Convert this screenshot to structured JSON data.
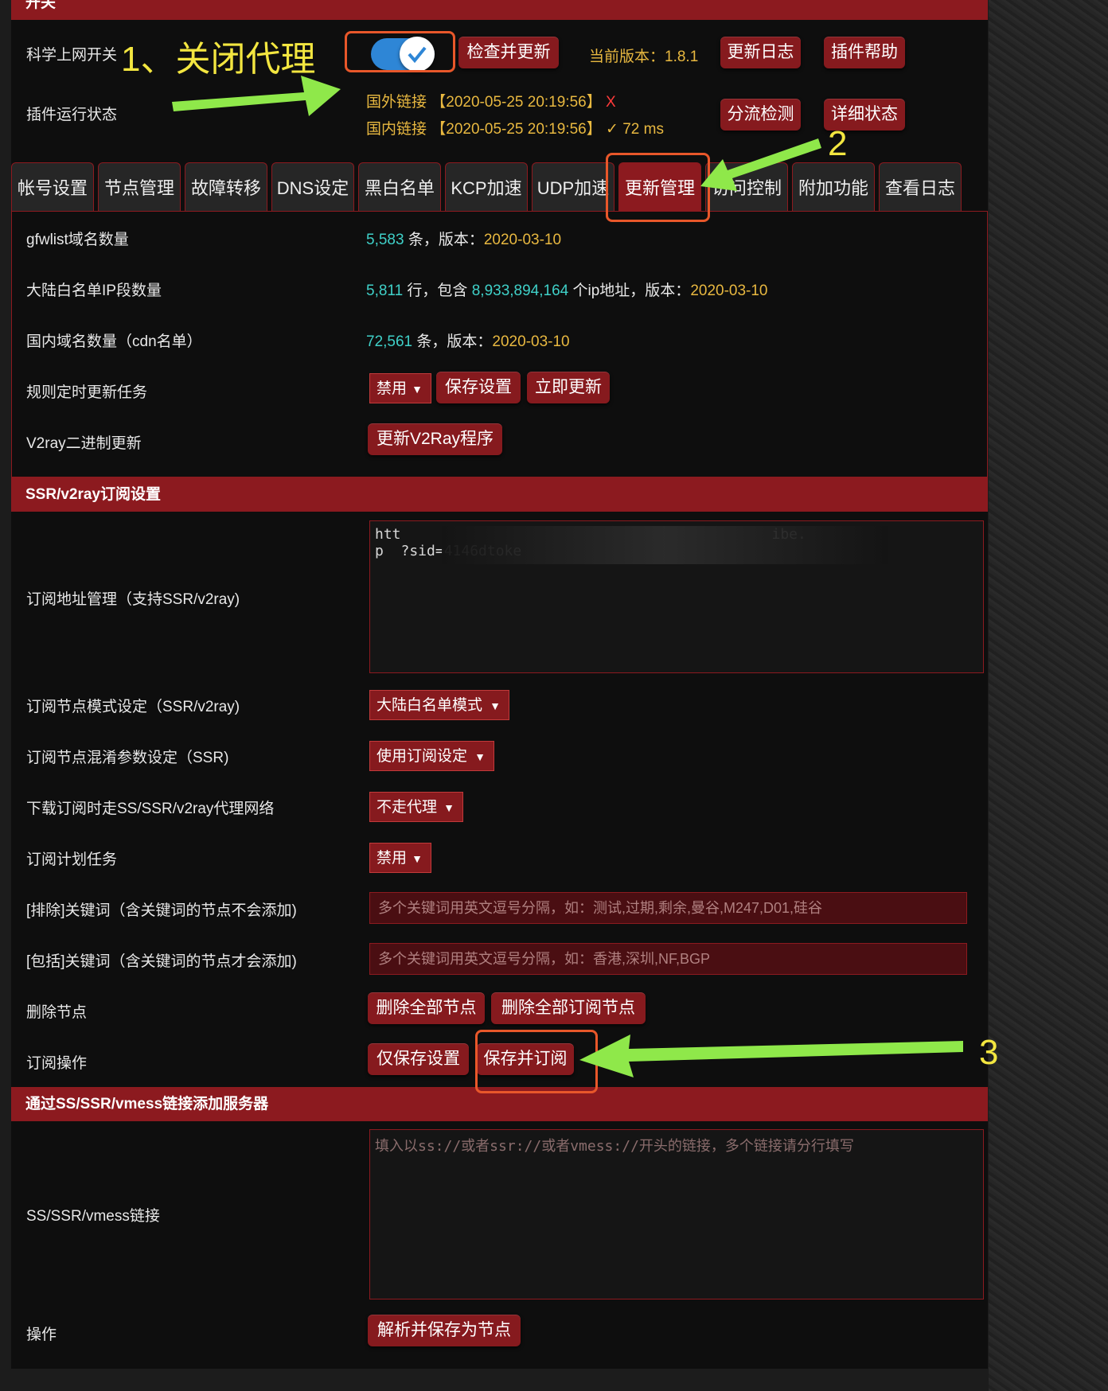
{
  "header": {
    "switch_section": "开关"
  },
  "switch_row": {
    "label": "科学上网开关",
    "check_update": "检查并更新",
    "version_label": "当前版本：",
    "version_value": "1.8.1",
    "changelog": "更新日志",
    "plugin_help": "插件帮助"
  },
  "status_row": {
    "label": "插件运行状态",
    "foreign_link": "国外链接 【2020-05-25 20:19:56】",
    "foreign_mark": "X",
    "domestic_link": "国内链接 【2020-05-25 20:19:56】",
    "domestic_mark": "✓ 72 ms",
    "split_check": "分流检测",
    "detail_status": "详细状态"
  },
  "tabs": [
    {
      "label": "帐号设置"
    },
    {
      "label": "节点管理"
    },
    {
      "label": "故障转移"
    },
    {
      "label": "DNS设定"
    },
    {
      "label": "黑白名单"
    },
    {
      "label": "KCP加速"
    },
    {
      "label": "UDP加速"
    },
    {
      "label": "更新管理"
    },
    {
      "label": "访问控制"
    },
    {
      "label": "附加功能"
    },
    {
      "label": "查看日志"
    }
  ],
  "rules": {
    "gfwlist_label": "gfwlist域名数量",
    "gfwlist_count": "5,583",
    "gfwlist_unit": "条，版本：",
    "gfwlist_version": "2020-03-10",
    "chnroute_label": "大陆白名单IP段数量",
    "chnroute_count": "5,811",
    "chnroute_mid": "行，包含",
    "chnroute_ips": "8,933,894,164",
    "chnroute_unit": "个ip地址，版本：",
    "chnroute_version": "2020-03-10",
    "cdn_label": "国内域名数量（cdn名单）",
    "cdn_count": "72,561",
    "cdn_unit": "条，版本：",
    "cdn_version": "2020-03-10",
    "schedule_label": "规则定时更新任务",
    "schedule_value": "禁用",
    "save_settings": "保存设置",
    "update_now": "立即更新",
    "v2ray_label": "V2ray二进制更新",
    "v2ray_button": "更新V2Ray程序"
  },
  "subscription": {
    "section_title": "SSR/v2ray订阅设置",
    "url_label": "订阅地址管理（支持SSR/v2ray)",
    "url_line1": "htt                                           ibe.",
    "url_line2": "p  ?sid=4146dtoke",
    "mode_label": "订阅节点模式设定（SSR/v2ray)",
    "mode_value": "大陆白名单模式",
    "obfs_label": "订阅节点混淆参数设定（SSR)",
    "obfs_value": "使用订阅设定",
    "proxy_label": "下载订阅时走SS/SSR/v2ray代理网络",
    "proxy_value": "不走代理",
    "cron_label": "订阅计划任务",
    "cron_value": "禁用",
    "exclude_label": "[排除]关键词（含关键词的节点不会添加)",
    "exclude_placeholder": "多个关键词用英文逗号分隔，如：测试,过期,剩余,曼谷,M247,D01,硅谷",
    "include_label": "[包括]关键词（含关键词的节点才会添加)",
    "include_placeholder": "多个关键词用英文逗号分隔，如：香港,深圳,NF,BGP",
    "delete_label": "删除节点",
    "delete_all": "删除全部节点",
    "delete_sub": "删除全部订阅节点",
    "action_label": "订阅操作",
    "save_only": "仅保存设置",
    "save_subscribe": "保存并订阅"
  },
  "links": {
    "section_title": "通过SS/SSR/vmess链接添加服务器",
    "link_label": "SS/SSR/vmess链接",
    "link_placeholder": "填入以ss://或者ssr://或者vmess://开头的链接，多个链接请分行填写",
    "action_label": "操作",
    "parse_button": "解析并保存为节点"
  },
  "annotations": {
    "step1": "1、关闭代理",
    "step2": "2",
    "step3": "3"
  }
}
